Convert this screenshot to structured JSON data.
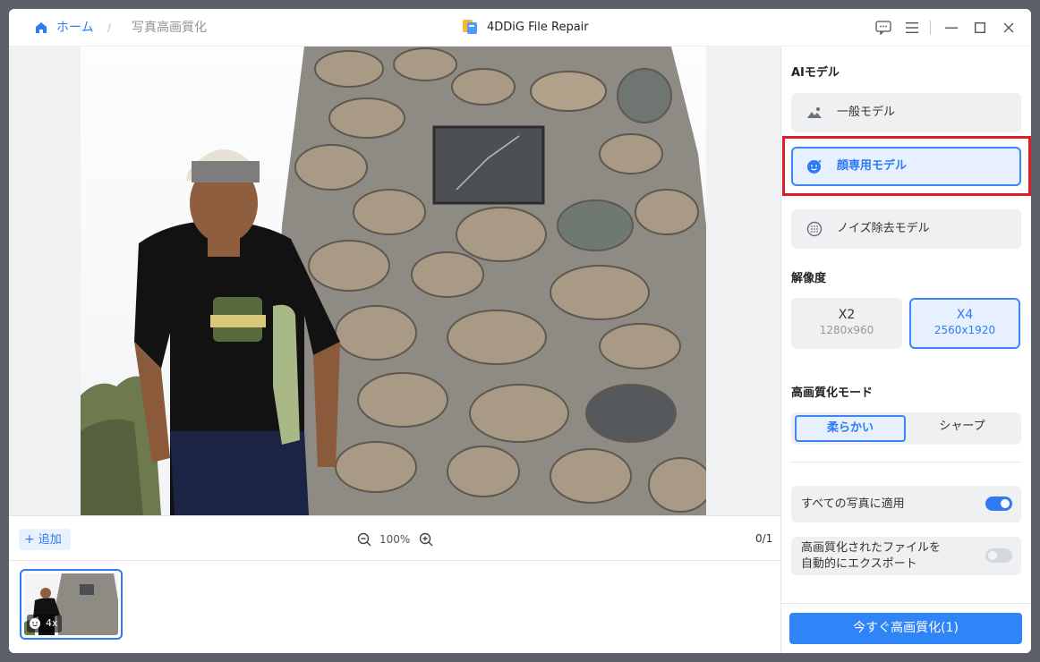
{
  "titlebar": {
    "home_label": "ホーム",
    "separator": "/",
    "current_page": "写真高画質化",
    "app_title": "4DDiG File Repair"
  },
  "image_toolbar": {
    "add_label": "追加",
    "zoom_level": "100%",
    "page_counter": "0/1"
  },
  "thumbnails": [
    {
      "badge": "4x"
    }
  ],
  "panel": {
    "ai_model_title": "AIモデル",
    "models": [
      {
        "label": "一般モデル",
        "icon": "image-icon",
        "selected": false
      },
      {
        "label": "顔専用モデル",
        "icon": "face-icon",
        "selected": true
      },
      {
        "label": "ノイズ除去モデル",
        "icon": "noise-icon",
        "selected": false
      }
    ],
    "resolution_title": "解像度",
    "resolutions": [
      {
        "label": "X2",
        "size": "1280x960",
        "selected": false
      },
      {
        "label": "X4",
        "size": "2560x1920",
        "selected": true
      }
    ],
    "mode_title": "高画質化モード",
    "modes": [
      {
        "label": "柔らかい",
        "selected": true
      },
      {
        "label": "シャープ",
        "selected": false
      }
    ],
    "apply_all_label": "すべての写真に適用",
    "apply_all_on": true,
    "auto_export_label_line1": "高画質化されたファイルを",
    "auto_export_label_line2": "自動的にエクスポート",
    "auto_export_on": false,
    "enhance_button": "今すぐ高画質化(1)"
  },
  "colors": {
    "accent": "#2f7bf5",
    "highlight": "#e01c2a",
    "panel_bg": "#eff0f2",
    "selected_bg": "#e6f0fe"
  }
}
